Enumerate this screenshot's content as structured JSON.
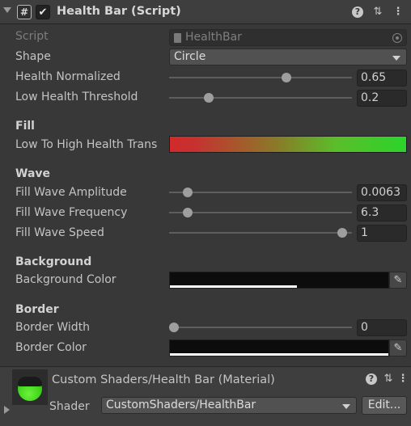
{
  "header": {
    "title": "Health Bar (Script)",
    "enabled": true,
    "icons": [
      "fold-arrow-icon",
      "script-icon",
      "checkbox-icon",
      "help-icon",
      "presets-icon",
      "kebab-menu-icon"
    ]
  },
  "script": {
    "label": "Script",
    "value": "HealthBar"
  },
  "shape": {
    "label": "Shape",
    "value": "Circle"
  },
  "health_normalized": {
    "label": "Health Normalized",
    "value": "0.65",
    "fraction": 0.65
  },
  "low_health_threshold": {
    "label": "Low Health Threshold",
    "value": "0.2",
    "fraction": 0.2
  },
  "fill": {
    "section": "Fill",
    "gradient_label": "Low To High Health Trans",
    "gradient_colors": [
      "#d12a2a",
      "#8a7a28",
      "#2bd42b"
    ]
  },
  "wave": {
    "section": "Wave",
    "amplitude": {
      "label": "Fill Wave Amplitude",
      "value": "0.0063",
      "fraction": 0.08
    },
    "frequency": {
      "label": "Fill Wave Frequency",
      "value": "6.3",
      "fraction": 0.08
    },
    "speed": {
      "label": "Fill Wave Speed",
      "value": "1",
      "fraction": 0.97
    }
  },
  "background": {
    "section": "Background",
    "color_label": "Background Color",
    "color": "#0c0c0c",
    "alpha": 0.58
  },
  "border": {
    "section": "Border",
    "width_label": "Border Width",
    "width_value": "0",
    "width_fraction": 0.0,
    "color_label": "Border Color",
    "color": "#0c0c0c",
    "alpha": 1.0
  },
  "material": {
    "title": "Custom Shaders/Health Bar (Material)",
    "shader_label": "Shader",
    "shader_value": "CustomShaders/HealthBar",
    "edit_label": "Edit..."
  }
}
